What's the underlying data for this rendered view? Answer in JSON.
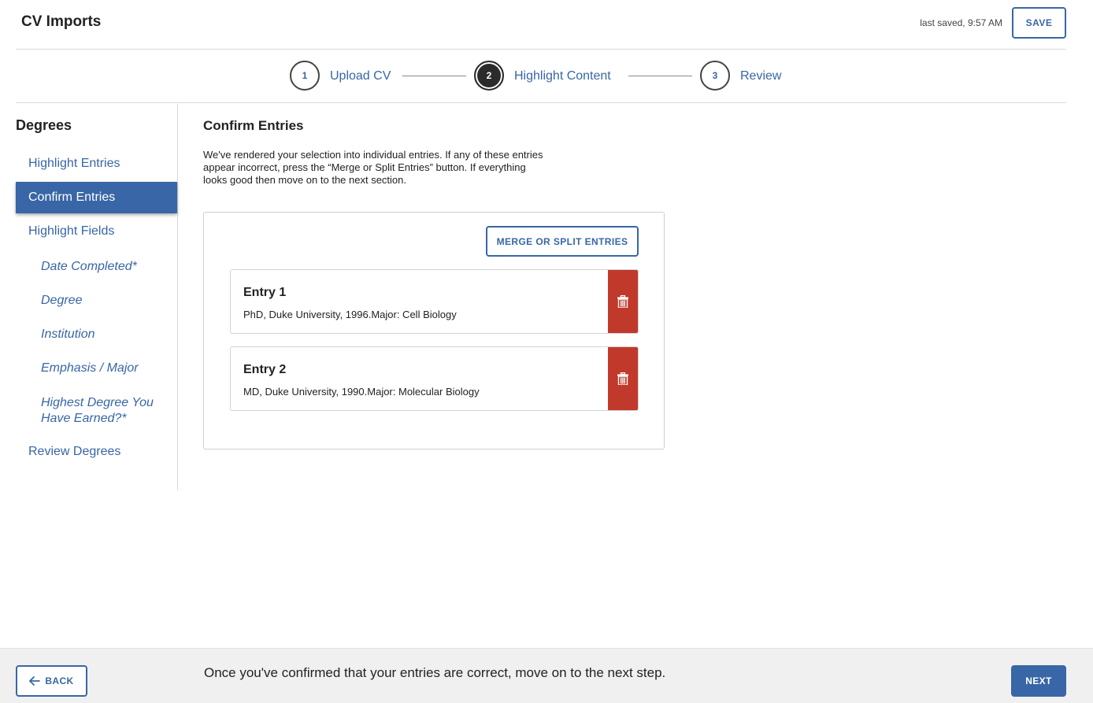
{
  "header": {
    "title": "CV Imports",
    "last_saved": "last saved, 9:57 AM",
    "save_label": "SAVE"
  },
  "stepper": {
    "steps": [
      {
        "number": "1",
        "label": "Upload CV",
        "state": "complete"
      },
      {
        "number": "2",
        "label": "Highlight Content",
        "state": "active"
      },
      {
        "number": "3",
        "label": "Review",
        "state": "upcoming"
      }
    ]
  },
  "sidebar": {
    "heading": "Degrees",
    "items": [
      {
        "label": "Highlight Entries"
      },
      {
        "label": "Confirm Entries",
        "active": true
      },
      {
        "label": "Highlight Fields"
      },
      {
        "label": "Date Completed*"
      },
      {
        "label": "Degree"
      },
      {
        "label": "Institution"
      },
      {
        "label": "Emphasis / Major"
      },
      {
        "label": "Highest Degree You Have Earned?*"
      },
      {
        "label": "Review Degrees"
      }
    ]
  },
  "main": {
    "title": "Confirm Entries",
    "description": "We've rendered your selection into individual entries. If any of these entries appear incorrect, press the “Merge or Split Entries” button. If everything looks good then move on to the next section.",
    "merge_label": "MERGE OR SPLIT ENTRIES",
    "entries": [
      {
        "title": "Entry 1",
        "text": "PhD, Duke University, 1996.Major: Cell Biology"
      },
      {
        "title": "Entry 2",
        "text": "MD, Duke University, 1990.Major: Molecular Biology"
      }
    ]
  },
  "footer": {
    "back_label": "BACK",
    "message": "Once you've confirmed that your entries are correct, move on to the next step.",
    "next_label": "NEXT"
  },
  "colors": {
    "accent": "#3866a6",
    "danger": "#c0392b",
    "footer_bg": "#f0f0f0"
  },
  "icons": {
    "delete": "trash-icon",
    "back": "arrow-left-icon"
  }
}
